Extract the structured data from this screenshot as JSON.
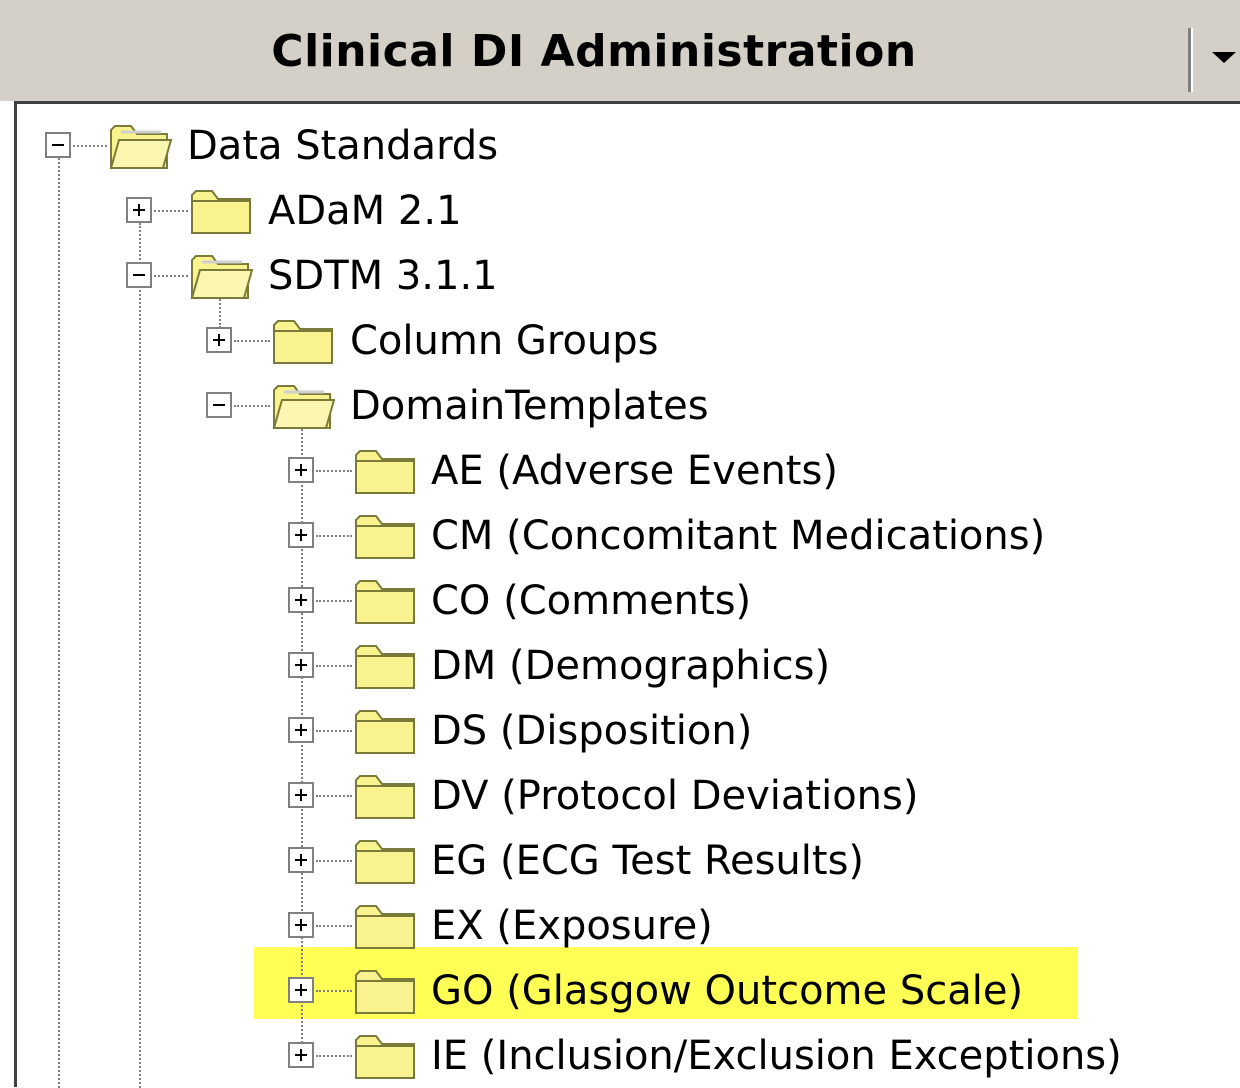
{
  "header": {
    "title": "Clinical DI Administration",
    "dropdown_icon": "chevron-down-icon"
  },
  "colors": {
    "header_bg": "#d4d0c8",
    "folder_fill": "#f9f38f",
    "folder_stroke": "#7a7a3a",
    "highlight": "#ffff55"
  },
  "tree": {
    "root": {
      "label": "Data Standards",
      "expanded": true,
      "icon": "folder-open-icon"
    },
    "adam": {
      "label": "ADaM 2.1",
      "expanded": false,
      "icon": "folder-icon"
    },
    "sdtm": {
      "label": "SDTM 3.1.1",
      "expanded": true,
      "icon": "folder-open-icon"
    },
    "column_groups": {
      "label": "Column Groups",
      "expanded": false,
      "icon": "folder-icon"
    },
    "domain_templates": {
      "label": "DomainTemplates",
      "expanded": true,
      "icon": "folder-open-icon"
    },
    "domains": [
      {
        "label": "AE (Adverse Events)",
        "selected": false
      },
      {
        "label": "CM (Concomitant Medications)",
        "selected": false
      },
      {
        "label": "CO (Comments)",
        "selected": false
      },
      {
        "label": "DM (Demographics)",
        "selected": false
      },
      {
        "label": "DS (Disposition)",
        "selected": false
      },
      {
        "label": "DV (Protocol Deviations)",
        "selected": false
      },
      {
        "label": "EG (ECG Test Results)",
        "selected": false
      },
      {
        "label": "EX (Exposure)",
        "selected": false
      },
      {
        "label": "GO (Glasgow Outcome Scale)",
        "selected": true
      },
      {
        "label": "IE (Inclusion/Exclusion Exceptions)",
        "selected": false
      }
    ]
  }
}
